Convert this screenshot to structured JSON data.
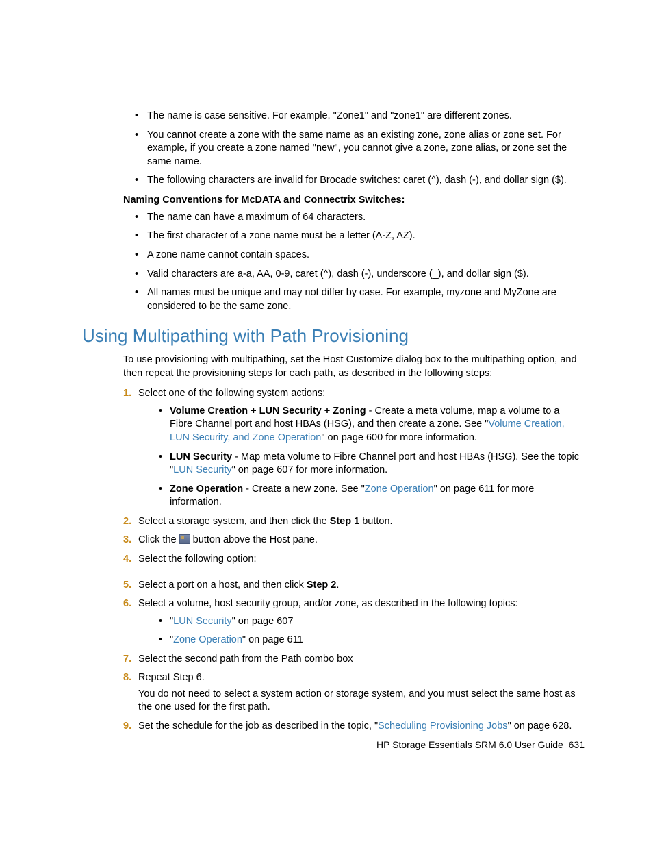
{
  "top_bullets": [
    "The name is case sensitive. For example, \"Zone1\" and \"zone1\" are different zones.",
    "You cannot create a zone with the same name as an existing zone, zone alias or zone set. For example, if you create a zone named \"new\", you cannot give a zone, zone alias, or zone set the same name.",
    "The following characters are invalid for Brocade switches: caret (^), dash (-), and dollar sign ($)."
  ],
  "subhead": "Naming Conventions for McDATA and Connectrix Switches",
  "subhead_colon": ":",
  "mc_bullets": [
    "The name can have a maximum of 64 characters.",
    "The first character of a zone name must be a letter (A-Z, AZ).",
    "A zone name cannot contain spaces.",
    "Valid characters are a-a, AA, 0-9, caret (^), dash (-), underscore (_), and dollar sign ($).",
    "All names must be unique and may not differ by case. For example, myzone and MyZone are considered to be the same zone."
  ],
  "section_title": "Using Multipathing with Path Provisioning",
  "intro": "To use provisioning with multipathing, set the Host Customize dialog box to the multipathing option, and then repeat the provisioning steps for each path, as described in the following steps:",
  "step1": {
    "num": "1.",
    "text": "Select one of the following system actions:",
    "a_bold": "Volume Creation + LUN Security + Zoning",
    "a_rest1": " - Create a meta volume, map a volume to a Fibre Channel port and host HBAs (HSG), and then create a zone. See \"",
    "a_link": "Volume Creation, LUN Security, and Zone Operation",
    "a_rest2": "\" on page 600 for more information.",
    "b_bold": "LUN Security",
    "b_rest1": " - Map meta volume to Fibre Channel port and host HBAs (HSG). See the topic \"",
    "b_link": "LUN Security",
    "b_rest2": "\" on page 607 for more information.",
    "c_bold": "Zone Operation",
    "c_rest1": " - Create a new zone. See \"",
    "c_link": "Zone Operation",
    "c_rest2": "\" on page 611 for more information."
  },
  "step2": {
    "num": "2.",
    "pre": "Select a storage system, and then click the ",
    "bold": "Step 1",
    "post": " button."
  },
  "step3": {
    "num": "3.",
    "pre": "Click the ",
    "post": " button above the Host pane."
  },
  "step4": {
    "num": "4.",
    "text": "Select the following option:"
  },
  "step5": {
    "num": "5.",
    "pre": "Select a port on a host, and then click ",
    "bold": "Step 2",
    "post": "."
  },
  "step6": {
    "num": "6.",
    "text": "Select a volume, host security group, and/or zone, as described in the following topics:",
    "a_pre": "\"",
    "a_link": "LUN Security",
    "a_post": "\" on page 607",
    "b_pre": "\"",
    "b_link": "Zone Operation",
    "b_post": "\" on page 611"
  },
  "step7": {
    "num": "7.",
    "text": "Select the second path from the Path combo box"
  },
  "step8": {
    "num": "8.",
    "text": "Repeat Step 6.",
    "note": "You do not need to select a system action or storage system, and you must select the same host as the one used for the first path."
  },
  "step9": {
    "num": "9.",
    "pre": "Set the schedule for the job as described in the topic, \"",
    "link": "Scheduling Provisioning Jobs",
    "post": "\" on page 628."
  },
  "footer_doc": "HP Storage Essentials SRM 6.0 User Guide",
  "footer_page": "631"
}
